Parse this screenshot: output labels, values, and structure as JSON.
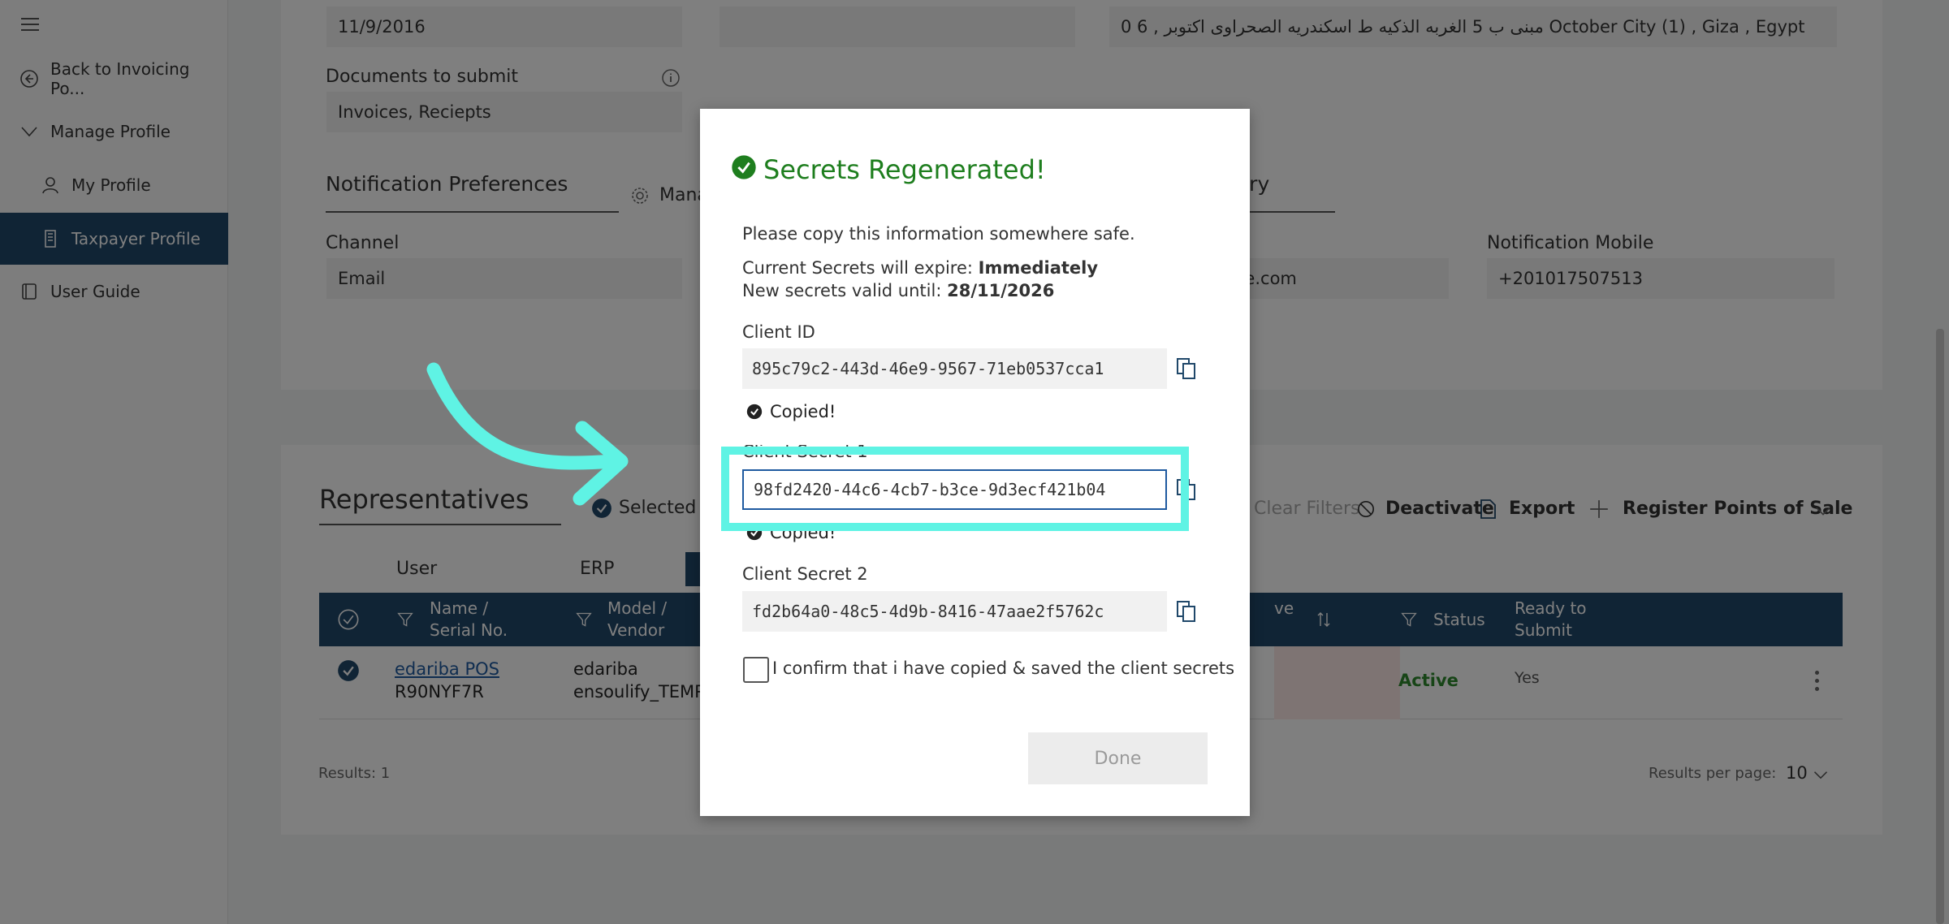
{
  "sidebar": {
    "items": [
      {
        "label": "Back to Invoicing Po..."
      },
      {
        "label": "Manage Profile"
      },
      {
        "label": "My Profile"
      },
      {
        "label": "Taxpayer Profile"
      },
      {
        "label": "User Guide"
      }
    ]
  },
  "profile": {
    "date_value": "11/9/2016",
    "address_value": "0  6 , مبنى ب 5 الغربه الذكيه ط اسكندريه الصحراوى اكتوبر October City (1) , Giza , Egypt",
    "documents_label": "Documents to submit",
    "documents_value": "Invoices, Reciepts",
    "notification_title": "Notification Preferences",
    "manage_link": "Mana",
    "delivery_fragment": "very",
    "channel_label": "Channel",
    "channel_value": "Email",
    "email_fragment": "ve.com",
    "mobile_label": "Notification Mobile",
    "mobile_value": "+201017507513"
  },
  "representatives": {
    "title": "Representatives",
    "selected_label": "Selected :",
    "clear_filters": "Clear Filters",
    "deactivate": "Deactivate",
    "export": "Export",
    "register_pos": "Register Points of Sale",
    "subtabs": [
      "User",
      "ERP"
    ],
    "columns": {
      "name_line1": "Name /",
      "name_line2": "Serial No.",
      "model_line1": "Model /",
      "model_line2": "Vendor",
      "ve_fragment": "ve",
      "status": "Status",
      "ready_line1": "Ready to",
      "ready_line2": "Submit"
    },
    "row": {
      "name": "edariba POS",
      "serial": "R90NYF7R",
      "model": "edariba",
      "vendor": "ensoulify_TEMP",
      "status": "Active",
      "ready": "Yes"
    },
    "results_label": "Results: 1",
    "per_page_label": "Results per page:",
    "per_page_value": "10"
  },
  "modal": {
    "title": "Secrets Regenerated!",
    "intro": "Please copy this information somewhere safe.",
    "expire_label": "Current Secrets will expire:",
    "expire_value": "Immediately",
    "valid_label": "New secrets valid until:",
    "valid_value": "28/11/2026",
    "client_id_label": "Client ID",
    "client_id_value": "895c79c2-443d-46e9-9567-71eb0537cca1",
    "copied_text": "Copied!",
    "secret1_label": "Client Secret 1",
    "secret1_value": "98fd2420-44c6-4cb7-b3ce-9d3ecf421b04",
    "secret2_label": "Client Secret 2",
    "secret2_value": "fd2b64a0-48c5-4d9b-8416-47aae2f5762c",
    "confirm_text": "I confirm that i have copied & saved the client secrets",
    "done_label": "Done"
  },
  "colors": {
    "header_blue": "#20486a",
    "success_green": "#1e7e1e",
    "highlight_cyan": "#5ff3e4",
    "status_green": "#2e8b2e"
  }
}
